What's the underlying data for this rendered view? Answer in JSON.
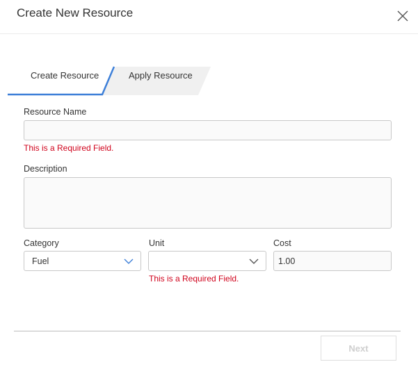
{
  "dialog": {
    "title": "Create New Resource"
  },
  "steps": [
    {
      "label": "Create Resource",
      "active": true
    },
    {
      "label": "Apply Resource",
      "active": false
    }
  ],
  "form": {
    "resource_name": {
      "label": "Resource Name",
      "value": "",
      "error": "This is a Required Field."
    },
    "description": {
      "label": "Description",
      "value": ""
    },
    "category": {
      "label": "Category",
      "value": "Fuel"
    },
    "unit": {
      "label": "Unit",
      "value": "",
      "error": "This is a Required Field."
    },
    "cost": {
      "label": "Cost",
      "value": "1.00"
    }
  },
  "footer": {
    "next_label": "Next",
    "next_enabled": false
  },
  "colors": {
    "accent": "#3d7fd8",
    "error": "#d0021b",
    "tab_inactive": "#f0f0f0"
  },
  "icons": {
    "close": "close-icon",
    "dropdown": "chevron-down-icon"
  }
}
